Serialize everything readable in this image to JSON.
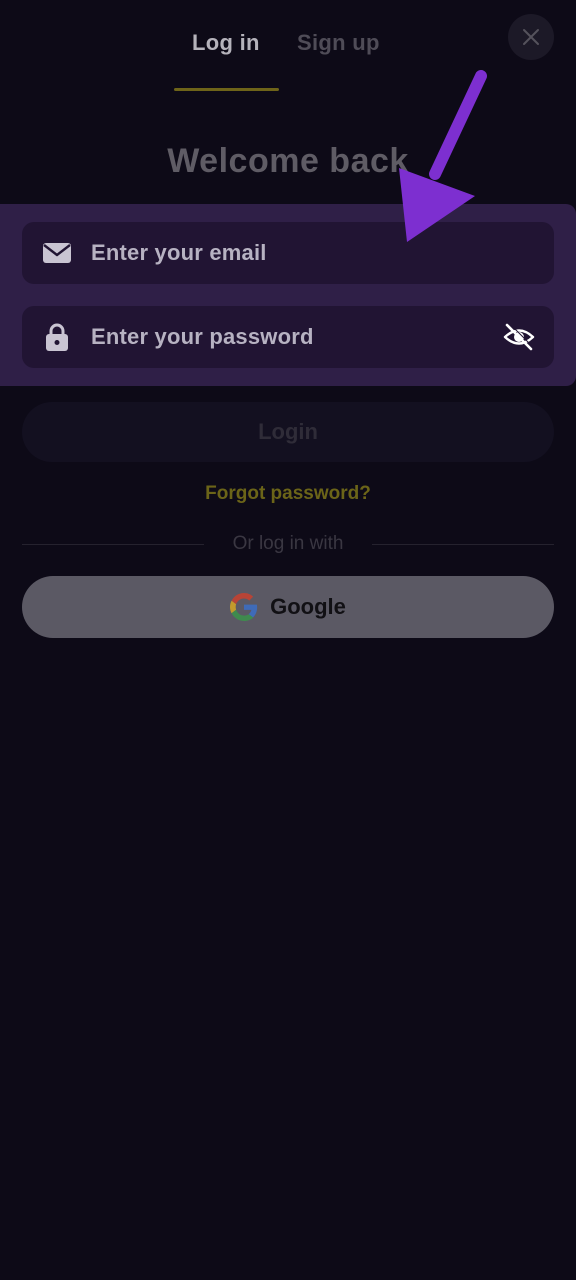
{
  "tabs": {
    "login": "Log in",
    "signup": "Sign up",
    "active": "login"
  },
  "header": {
    "close_icon": "close-icon"
  },
  "welcome": {
    "title": "Welcome back"
  },
  "form": {
    "email": {
      "placeholder": "Enter your email",
      "value": "",
      "icon": "envelope-icon"
    },
    "password": {
      "placeholder": "Enter your password",
      "value": "",
      "icon": "lock-icon",
      "toggle_icon": "eye-off-icon"
    },
    "login_button": "Login",
    "forgot_link": "Forgot password?"
  },
  "social": {
    "divider_text": "Or log in with",
    "google_button": "Google",
    "google_icon": "google-logo-icon"
  },
  "colors": {
    "background": "#0d0a17",
    "highlight_panel": "#2f1f47",
    "input_background": "#211433",
    "accent_yellow": "#6b6418",
    "arrow_purple": "#7d2fd0"
  }
}
